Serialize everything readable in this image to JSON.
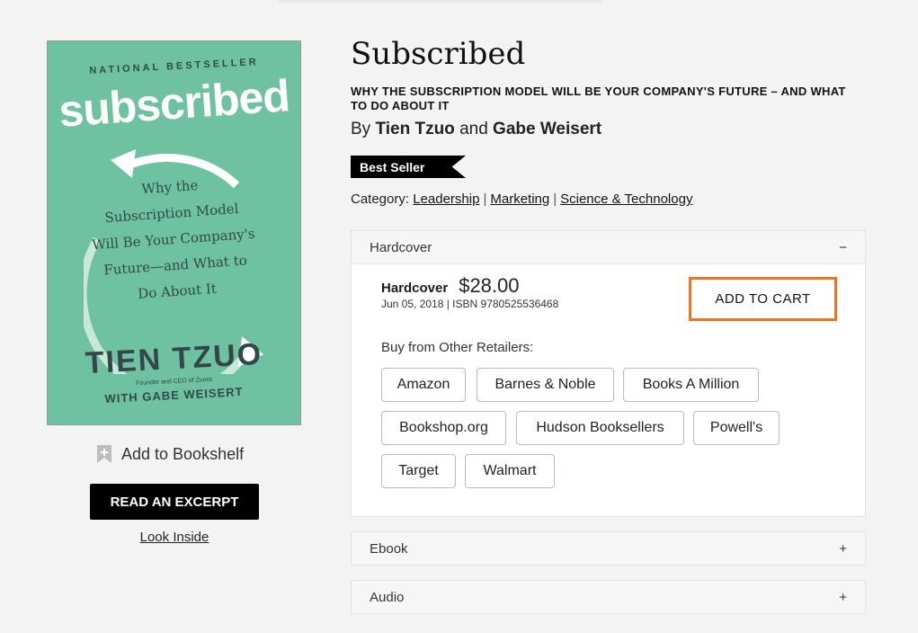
{
  "book": {
    "title": "Subscribed",
    "subtitle": "WHY THE SUBSCRIPTION MODEL WILL BE YOUR COMPANY'S FUTURE – AND WHAT TO DO ABOUT IT",
    "by_prefix": "By",
    "author1": "Tien Tzuo",
    "and_word": "and",
    "author2": "Gabe Weisert",
    "badge": "Best Seller",
    "category_prefix": "Category:",
    "categories": [
      "Leadership",
      "Marketing",
      "Science & Technology"
    ],
    "separator": "|"
  },
  "cover": {
    "tagline": "NATIONAL BESTSELLER",
    "title": "subscribed",
    "subtitle_lines": [
      "Why the",
      "Subscription Model",
      "Will Be Your Company's",
      "Future—and What to",
      "Do About It"
    ],
    "author": "TIEN TZUO",
    "role": "Founder and CEO of Zuora",
    "with": "WITH GABE WEISERT",
    "background": "#6fc2a1"
  },
  "left": {
    "bookshelf_label": "Add to Bookshelf",
    "excerpt_label": "READ AN EXCERPT",
    "look_inside": "Look Inside"
  },
  "formats": {
    "hardcover": {
      "header": "Hardcover",
      "toggle": "−",
      "name": "Hardcover",
      "price": "$28.00",
      "meta": "Jun 05, 2018 | ISBN 9780525536468",
      "cart_label": "ADD TO CART",
      "retailers_label": "Buy from Other Retailers:",
      "retailers": [
        "Amazon",
        "Barnes & Noble",
        "Books A Million",
        "Bookshop.org",
        "Hudson Booksellers",
        "Powell's",
        "Target",
        "Walmart"
      ]
    },
    "ebook": {
      "header": "Ebook",
      "toggle": "+"
    },
    "audio": {
      "header": "Audio",
      "toggle": "+"
    }
  },
  "colors": {
    "accent_orange": "#e87722",
    "badge_black": "#000000"
  }
}
